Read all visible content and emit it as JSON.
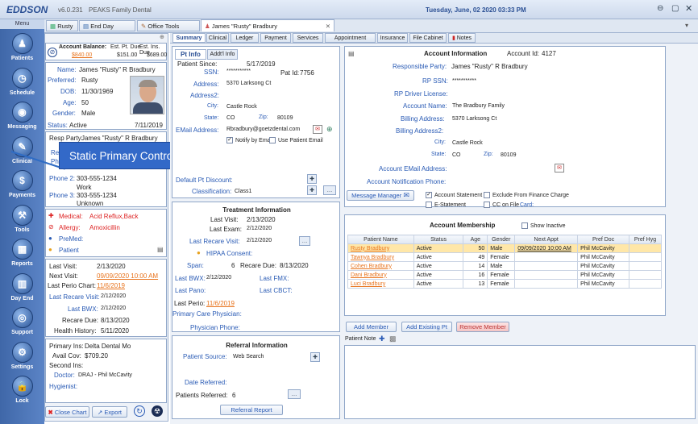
{
  "app": {
    "logo": "EDDSON",
    "version": "v6.0.231",
    "practice": "PEAKS Family Dental",
    "datetime": "Tuesday, June, 02 2020 03:33 PM"
  },
  "sidebar": {
    "menu": "Menu",
    "items": [
      "Patients",
      "Schedule",
      "Messaging",
      "Clinical",
      "Payments",
      "Tools",
      "Reports",
      "Day End",
      "Support",
      "Settings",
      "Lock"
    ]
  },
  "doc_tabs": [
    "Rusty",
    "End Day",
    "Office Tools",
    "James \"Rusty\" Bradbury"
  ],
  "subtabs": [
    "Summary",
    "Clinical",
    "Ledger",
    "Payment",
    "Services",
    "Appointment",
    "Insurance",
    "File Cabinet",
    "Notes"
  ],
  "left": {
    "balance": {
      "h1": "Account Balance:",
      "h2": "Est. Pt. Due",
      "h3": "Est. Ins. Due",
      "v1": "$840.00",
      "v2": "$151.00",
      "v3": "$689.00"
    },
    "patient": {
      "name_l": "Name:",
      "name": "James \"Rusty\" R Bradbury",
      "pref_l": "Preferred:",
      "pref": "Rusty",
      "dob_l": "DOB:",
      "dob": "11/30/1969",
      "age_l": "Age:",
      "age": "50",
      "gender_l": "Gender:",
      "gender": "Male",
      "status_l": "Status:",
      "status": "Active",
      "status_date": "7/11/2019"
    },
    "resp": {
      "label": "Resp Party:",
      "value": "James \"Rusty\" R Bradbury",
      "rel": "Rel",
      "ph": "Ph"
    },
    "phones": {
      "p2_l": "Phone 2:",
      "p2": "303-555-1234",
      "p2_t": "Work",
      "p3_l": "Phone 3:",
      "p3": "303-555-1234",
      "p3_t": "Unknown"
    },
    "alerts": {
      "medical_l": "Medical:",
      "medical": "Acid Reflux,Back",
      "allergy_l": "Allergy:",
      "allergy": "Amoxicillin",
      "premed": "PreMed:",
      "patient": "Patient"
    },
    "visits": {
      "last_l": "Last Visit:",
      "last": "2/13/2020",
      "next_l": "Next Visit:",
      "next": "09/09/2020 10:00 AM",
      "perio_l": "Last Perio Chart:",
      "perio": "11/6/2019",
      "recare_l": "Last Recare Visit:",
      "recare": "2/12/2020",
      "bwx_l": "Last BWX:",
      "bwx": "2/12/2020",
      "recdue_l": "Recare Due:",
      "recdue": "8/13/2020",
      "health_l": "Health History:",
      "health": "5/11/2020"
    },
    "ins": {
      "prim_l": "Primary Ins:",
      "prim": "Delta Dental Mo",
      "avail_l": "Avail Cov:",
      "avail": "$709.20",
      "sec_l": "Second Ins:",
      "doc_l": "Doctor:",
      "doc": "DRAJ - Phil McCavity",
      "hyg_l": "Hygienist:"
    },
    "buttons": {
      "close": "Close Chart",
      "export": "Export"
    }
  },
  "tooltip": "Static Primary Control - No Navigation Required",
  "ptinfo": {
    "tab1": "Pt Info",
    "tab2": "Addt'l Info",
    "since_l": "Patient Since:",
    "since": "5/17/2019",
    "ssn_l": "SSN:",
    "ssn": "***********",
    "patid_l": "Pat Id:",
    "patid": "7756",
    "addr_l": "Address:",
    "addr": "5370 Larksong Ct",
    "addr2_l": "Address2:",
    "city_l": "City:",
    "city": "Castle Rock",
    "state_l": "State:",
    "state": "CO",
    "zip_l": "Zip:",
    "zip": "80109",
    "email_l": "EMail Address:",
    "email": "Rbradbury@goetzdental.com",
    "notify": "Notify by Email",
    "usepe": "Use Patient Email",
    "disc_l": "Default Pt Discount:",
    "class_l": "Classification:",
    "class": "Class1"
  },
  "treatment": {
    "title": "Treatment Information",
    "last_l": "Last Visit:",
    "last": "2/13/2020",
    "exam_l": "Last Exam:",
    "exam": "2/12/2020",
    "recare_l": "Last Recare Visit:",
    "recare": "2/12/2020",
    "hipaa_l": "HIPAA Consent:",
    "span_l": "Span:",
    "span": "6",
    "recdue_l": "Recare Due:",
    "recdue": "8/13/2020",
    "bwx_l": "Last BWX:",
    "bwx": "2/12/2020",
    "fmx_l": "Last FMX:",
    "pano_l": "Last Pano:",
    "cbct_l": "Last CBCT:",
    "perio_l": "Last Perio:",
    "perio": "11/6/2019",
    "pcp_l": "Primary Care Physician:",
    "phys_l": "Physician Phone:"
  },
  "referral": {
    "title": "Referral Information",
    "src_l": "Patient Source:",
    "src": "Web Search",
    "date_l": "Date Referred:",
    "count_l": "Patients Referred:",
    "count": "6",
    "btn": "Referral Report"
  },
  "account": {
    "title": "Account Information",
    "id_l": "Account Id:",
    "id": "4127",
    "resp_l": "Responsible Party:",
    "resp": "James \"Rusty\" R Bradbury",
    "rpssn_l": "RP SSN:",
    "rpssn": "***********",
    "rpdl_l": "RP Driver License:",
    "acct_l": "Account Name:",
    "acct": "The Bradbury Family",
    "bill_l": "Billing Address:",
    "bill": "5370 Larksong Ct",
    "bill2_l": "Billing Address2:",
    "city_l": "City:",
    "city": "Castle Rock",
    "state_l": "State:",
    "state": "CO",
    "zip_l": "Zip:",
    "zip": "80109",
    "email_l": "Account EMail Address:",
    "notif_l": "Account Notification Phone:",
    "msg_btn": "Message Manager",
    "stmt": "Account Statement",
    "fin": "Exclude From Finance Charge",
    "estmt": "E-Statement",
    "ccfile": "CC on File",
    "card": "Card:"
  },
  "membership": {
    "title": "Account Membership",
    "show_inactive": "Show Inactive",
    "cols": [
      "Patient Name",
      "Status",
      "Age",
      "Gender",
      "Next Appt",
      "Pref Doc",
      "Pref Hyg"
    ],
    "rows": [
      [
        "Rusty Bradbury",
        "Active",
        "50",
        "Male",
        "09/09/2020 10:00 AM",
        "Phil McCavity",
        ""
      ],
      [
        "Tawnya Bradbury",
        "Active",
        "49",
        "Female",
        "",
        "Phil McCavity",
        ""
      ],
      [
        "Cohen Bradbury",
        "Active",
        "14",
        "Male",
        "",
        "Phil McCavity",
        ""
      ],
      [
        "Dani Bradbury",
        "Active",
        "16",
        "Female",
        "",
        "Phil McCavity",
        ""
      ],
      [
        "Luci Bradbury",
        "Active",
        "13",
        "Female",
        "",
        "Phil McCavity",
        ""
      ]
    ],
    "add": "Add Member",
    "add_existing": "Add Existing Pt",
    "remove": "Remove Member",
    "note_l": "Patient Note"
  }
}
